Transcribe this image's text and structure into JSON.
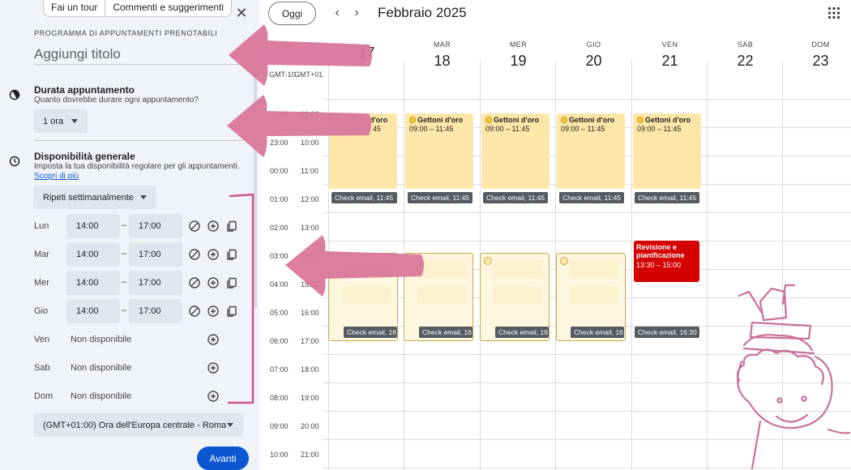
{
  "panel": {
    "tour_label": "Fai un tour",
    "feedback_label": "Commenti e suggerimenti",
    "eyebrow": "PROGRAMMA DI APPUNTAMENTI PRENOTABILI",
    "title_placeholder": "Aggiungi titolo",
    "duration": {
      "title": "Durata appuntamento",
      "subtitle": "Quanto dovrebbe durare ogni appuntamento?",
      "value": "1 ora"
    },
    "availability": {
      "title": "Disponibilità generale",
      "subtitle": "Imposta la tua disponibilità regolare per gli appuntamenti.",
      "link": "Scopri di più",
      "repeat": "Ripeti settimanalmente",
      "dash": "–",
      "days": [
        {
          "label": "Lun",
          "start": "14:00",
          "end": "17:00"
        },
        {
          "label": "Mar",
          "start": "14:00",
          "end": "17:00"
        },
        {
          "label": "Mer",
          "start": "14:00",
          "end": "17:00"
        },
        {
          "label": "Gio",
          "start": "14:00",
          "end": "17:00"
        },
        {
          "label": "Ven",
          "status": "Non disponibile"
        },
        {
          "label": "Sab",
          "status": "Non disponibile"
        },
        {
          "label": "Dom",
          "status": "Non disponibile"
        }
      ]
    },
    "timezone": "(GMT+01:00) Ora dell'Europa centrale - Roma",
    "next_label": "Avanti"
  },
  "calendar": {
    "today_label": "Oggi",
    "month": "Febbraio 2025",
    "tz_left": "GMT-10",
    "tz_right": "GMT+01",
    "days": [
      {
        "name": "",
        "date": "17"
      },
      {
        "name": "MAR",
        "date": "18"
      },
      {
        "name": "MER",
        "date": "19"
      },
      {
        "name": "GIO",
        "date": "20"
      },
      {
        "name": "VEN",
        "date": "21"
      },
      {
        "name": "SAB",
        "date": "22"
      },
      {
        "name": "DOM",
        "date": "23"
      }
    ],
    "hours_left": [
      "22:00",
      "23:00",
      "00:00",
      "01:00",
      "02:00",
      "03:00",
      "04:00",
      "05:00",
      "06:00",
      "07:00",
      "08:00",
      "09:00",
      "10:00"
    ],
    "hours_right": [
      "09:00",
      "10:00",
      "11:00",
      "12:00",
      "13:00",
      "14:00",
      "15:00",
      "16:00",
      "17:00",
      "18:00",
      "19:00",
      "20:00",
      "21:00"
    ],
    "events": {
      "gold_title": "Gettoni d'oro",
      "gold_title_clipped": "d'oro",
      "gold_time": "09:00 – 11:45",
      "gold_time_clipped": "45",
      "check_morning": "Check email, 11:45",
      "check_afternoon_clipped": "Check email, 16",
      "check_afternoon": "Check email, 16:30",
      "red_title": "Revisione e pianificazione",
      "red_time": "13:30 – 15:00"
    }
  },
  "colors": {
    "accent": "#0b57d0",
    "panel_bg": "#f0f4f9",
    "event_yellow": "#fde6a8",
    "event_red": "#d50000",
    "annotation_pink": "#d9779b"
  }
}
